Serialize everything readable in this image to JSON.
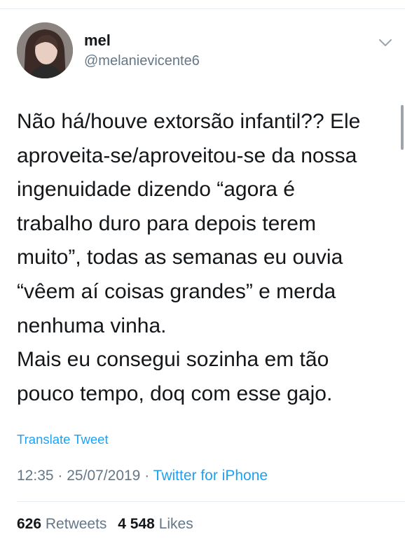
{
  "user": {
    "display_name": "mel",
    "handle": "@melanievicente6"
  },
  "tweet": {
    "text": "Não há/houve extorsão infantil?? Ele\naproveita-se/aproveitou-se da nossa\ningenuidade dizendo “agora é\ntrabalho duro para depois terem\nmuito”, todas as semanas eu ouvia\n“vêem aí coisas grandes” e merda\nnenhuma vinha.\nMais eu consegui sozinha em tão\npouco tempo, doq com esse gajo.",
    "translate_label": "Translate Tweet",
    "time": "12:35",
    "separator": "·",
    "date": "25/07/2019",
    "source": "Twitter for iPhone"
  },
  "stats": {
    "retweets_count": "626",
    "retweets_label": "Retweets",
    "likes_count": "4 548",
    "likes_label": "Likes"
  },
  "icons": {
    "menu": "chevron-down-icon"
  },
  "colors": {
    "link": "#1da1f2",
    "secondary_text": "#657786",
    "primary_text": "#14171a"
  }
}
